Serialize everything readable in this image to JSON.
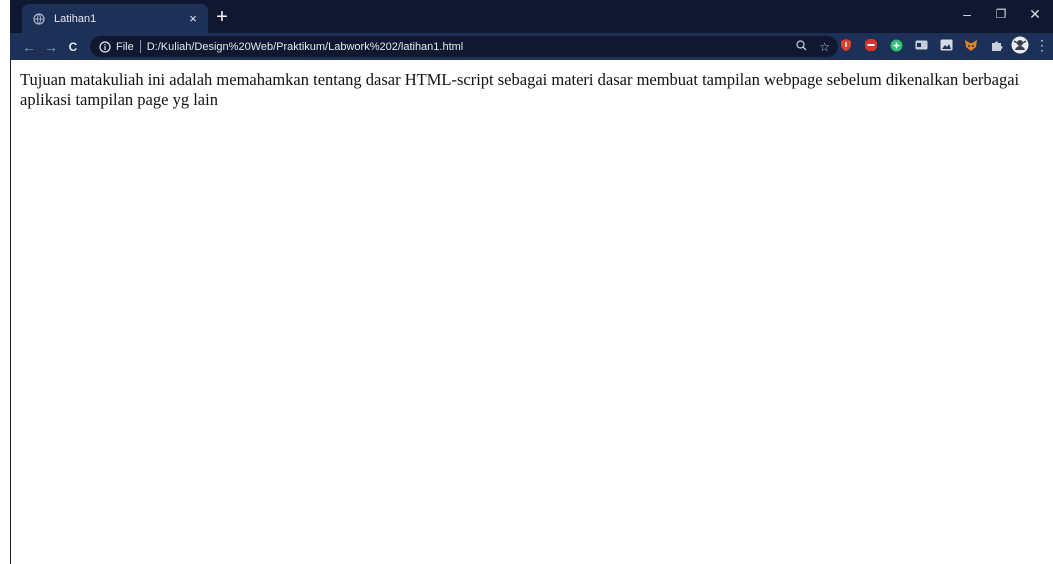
{
  "tab": {
    "title": "Latihan1",
    "close": "×",
    "new_tab": "+"
  },
  "window": {
    "minimize": "–",
    "restore": "❐",
    "close": "✕"
  },
  "toolbar": {
    "back": "←",
    "forward": "→",
    "reload": "C",
    "file_label": "File",
    "url": "D:/Kuliah/Design%20Web/Praktikum/Labwork%202/latihan1.html"
  },
  "content": {
    "paragraph": "Tujuan matakuliah ini adalah memahamkan tentang dasar HTML-script sebagai materi dasar membuat tampilan webpage sebelum dikenalkan berbagai aplikasi tampilan page yg lain"
  }
}
